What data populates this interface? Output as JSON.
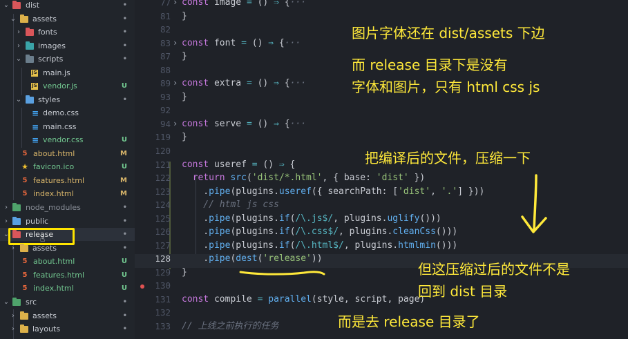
{
  "sidebar": {
    "items": [
      {
        "label": "dist",
        "status": "•"
      },
      {
        "label": "assets",
        "status": "•"
      },
      {
        "label": "fonts",
        "status": "•"
      },
      {
        "label": "images",
        "status": "•"
      },
      {
        "label": "scripts",
        "status": "•"
      },
      {
        "label": "main.js",
        "status": ""
      },
      {
        "label": "vendor.js",
        "status": "U"
      },
      {
        "label": "styles",
        "status": "•"
      },
      {
        "label": "demo.css",
        "status": ""
      },
      {
        "label": "main.css",
        "status": ""
      },
      {
        "label": "vendor.css",
        "status": "U"
      },
      {
        "label": "about.html",
        "status": "M"
      },
      {
        "label": "favicon.ico",
        "status": "U"
      },
      {
        "label": "features.html",
        "status": "M"
      },
      {
        "label": "index.html",
        "status": "M"
      },
      {
        "label": "node_modules",
        "status": "•"
      },
      {
        "label": "public",
        "status": "•"
      },
      {
        "label": "release",
        "status": "•"
      },
      {
        "label": "assets",
        "status": "•"
      },
      {
        "label": "about.html",
        "status": "U"
      },
      {
        "label": "features.html",
        "status": "U"
      },
      {
        "label": "index.html",
        "status": "U"
      },
      {
        "label": "src",
        "status": "•"
      },
      {
        "label": "assets",
        "status": "•"
      },
      {
        "label": "layouts",
        "status": "•"
      }
    ]
  },
  "editor": {
    "lines": [
      {
        "num": "77",
        "fold": "›",
        "text": "const image = () ⇒ {···"
      },
      {
        "num": "81",
        "fold": "",
        "text": "}"
      },
      {
        "num": "82",
        "fold": "",
        "text": ""
      },
      {
        "num": "83",
        "fold": "›",
        "text": "const font = () ⇒ {···"
      },
      {
        "num": "87",
        "fold": "",
        "text": "}"
      },
      {
        "num": "88",
        "fold": "",
        "text": ""
      },
      {
        "num": "89",
        "fold": "›",
        "text": "const extra = () ⇒ {···"
      },
      {
        "num": "93",
        "fold": "",
        "text": "}"
      },
      {
        "num": "92",
        "fold": "",
        "text": ""
      },
      {
        "num": "94",
        "fold": "›",
        "text": "const serve = () ⇒ {···"
      },
      {
        "num": "119",
        "fold": "",
        "text": "}"
      },
      {
        "num": "120",
        "fold": "",
        "text": ""
      },
      {
        "num": "121",
        "fold": "",
        "text": "const useref = () ⇒ {"
      },
      {
        "num": "122",
        "fold": "",
        "text": "  return src('dist/*.html', { base: 'dist' })"
      },
      {
        "num": "123",
        "fold": "",
        "text": "    .pipe(plugins.useref({ searchPath: ['dist', '.'] }))"
      },
      {
        "num": "124",
        "fold": "",
        "text": "    // html js css"
      },
      {
        "num": "125",
        "fold": "",
        "text": "    .pipe(plugins.if(/\\.js$/, plugins.uglify()))"
      },
      {
        "num": "126",
        "fold": "",
        "text": "    .pipe(plugins.if(/\\.css$/, plugins.cleanCss()))"
      },
      {
        "num": "127",
        "fold": "",
        "text": "    .pipe(plugins.if(/\\.html$/, plugins.htmlmin()))"
      },
      {
        "num": "128",
        "fold": "",
        "text": "    .pipe(dest('release'))"
      },
      {
        "num": "129",
        "fold": "",
        "text": "}"
      },
      {
        "num": "130",
        "fold": "",
        "text": ""
      },
      {
        "num": "131",
        "fold": "",
        "text": "const compile = parallel(style, script, page)"
      },
      {
        "num": "132",
        "fold": "",
        "text": ""
      },
      {
        "num": "133",
        "fold": "",
        "text": "// 上线之前执行的任务"
      }
    ]
  },
  "annotations": {
    "note1": "图片字体还在 dist/assets 下边",
    "note2a": "而 release 目录下是没有",
    "note2b": "字体和图片，只有 html css js",
    "note3": "把编译后的文件，压缩一下",
    "note4a": "但这压缩过后的文件不是",
    "note4b": "回到 dist 目录",
    "note5": "而是去 release 目录了"
  },
  "colors": {
    "annotation": "#ffe93a",
    "modified": "#d8b56a",
    "untracked": "#73c991",
    "highlight_box": "#ffe400"
  }
}
